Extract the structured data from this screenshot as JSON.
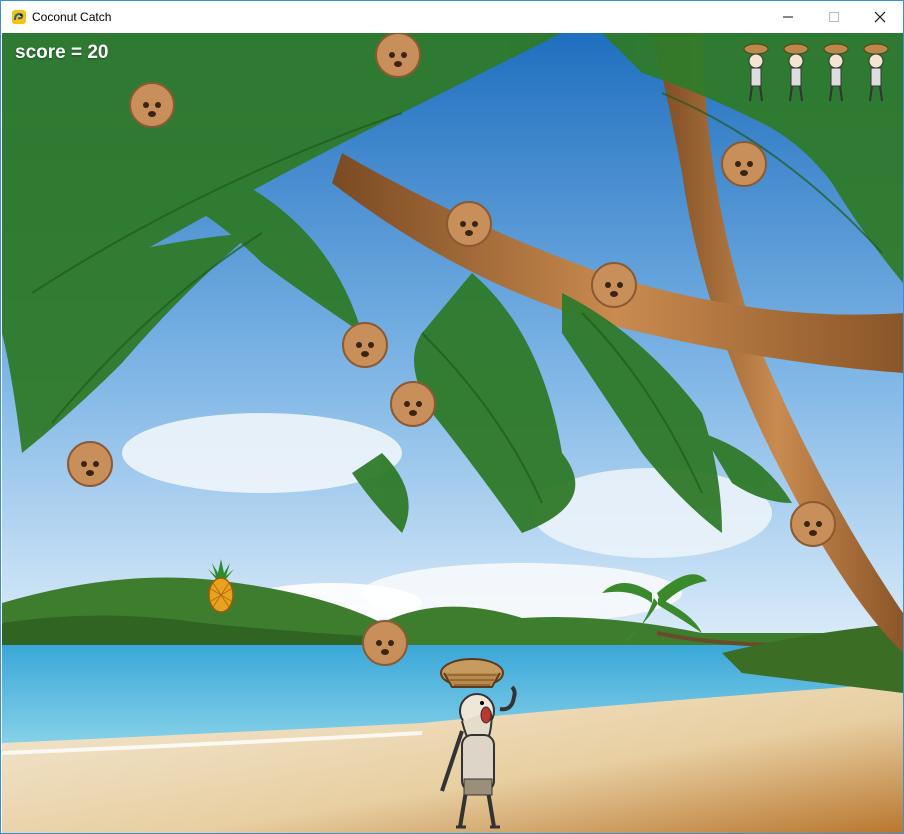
{
  "window": {
    "title": "Coconut Catch",
    "icon": "pygame-snake-icon",
    "controls": [
      "minimize-icon",
      "maximize-icon",
      "close-icon"
    ]
  },
  "hud": {
    "score_text": "score = 20",
    "score": 20,
    "lives_remaining": 4
  },
  "scene": {
    "background": "tropical-beach-palm-trees",
    "falling_items": [
      {
        "type": "coconut"
      },
      {
        "type": "coconut"
      },
      {
        "type": "coconut"
      },
      {
        "type": "coconut"
      },
      {
        "type": "coconut"
      },
      {
        "type": "coconut"
      },
      {
        "type": "coconut"
      },
      {
        "type": "coconut"
      },
      {
        "type": "coconut"
      },
      {
        "type": "coconut"
      },
      {
        "type": "pineapple"
      }
    ],
    "player": "castaway-with-basket-on-head"
  }
}
